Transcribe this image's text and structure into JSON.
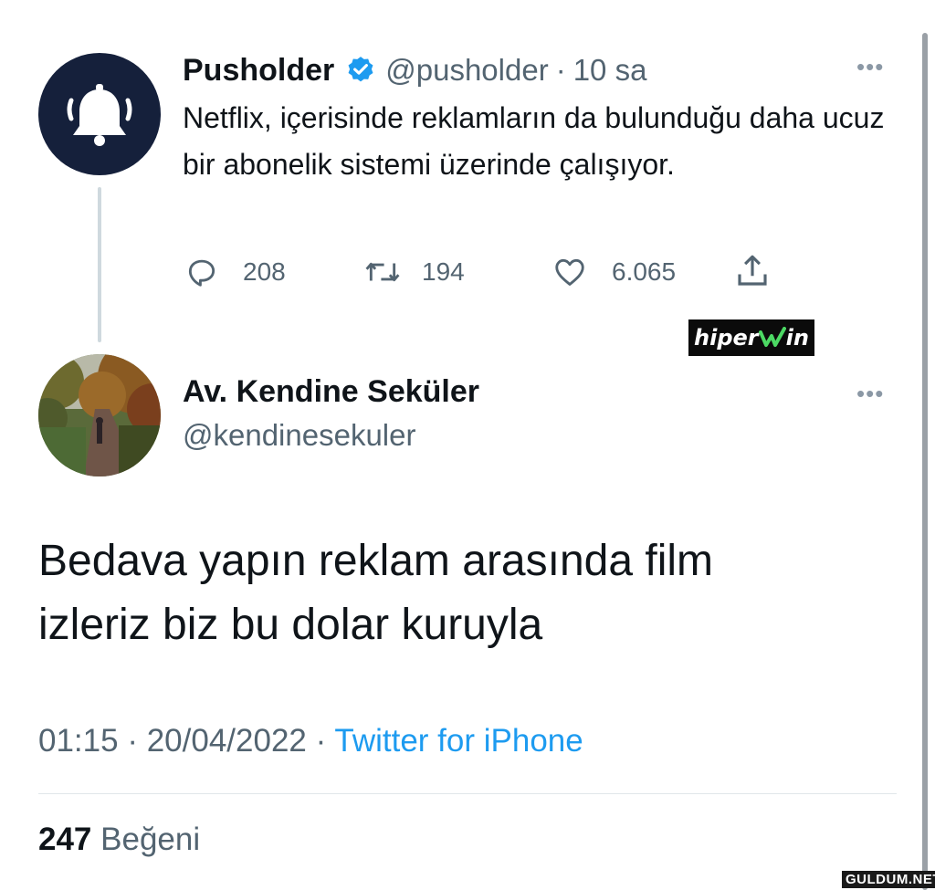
{
  "quoted_tweet": {
    "author_name": "Pusholder",
    "author_handle": "@pusholder",
    "separator": "·",
    "time": "10 sa",
    "text": "Netflix, içerisinde reklamların da bulunduğu daha ucuz bir abonelik sistemi üzerinde çalışıyor.",
    "replies": "208",
    "retweets": "194",
    "likes": "6.065",
    "more_icon": "ellipsis-icon"
  },
  "ad_badge": {
    "text_left": "hiper",
    "text_right": "in"
  },
  "main_tweet": {
    "author_name": "Av. Kendine Seküler",
    "author_handle": "@kendinesekuler",
    "text": "Bedava yapın reklam arasında film izleriz biz bu dolar kuruyla",
    "time": "01:15",
    "dot1": "·",
    "date": "20/04/2022",
    "dot2": "·",
    "source": "Twitter for iPhone",
    "like_count": "247",
    "like_label": "Beğeni"
  },
  "watermark": "GULDUM.NET",
  "colors": {
    "verified": "#1d9bf0",
    "link": "#1d9bf0",
    "avatar_bg": "#15203b"
  }
}
